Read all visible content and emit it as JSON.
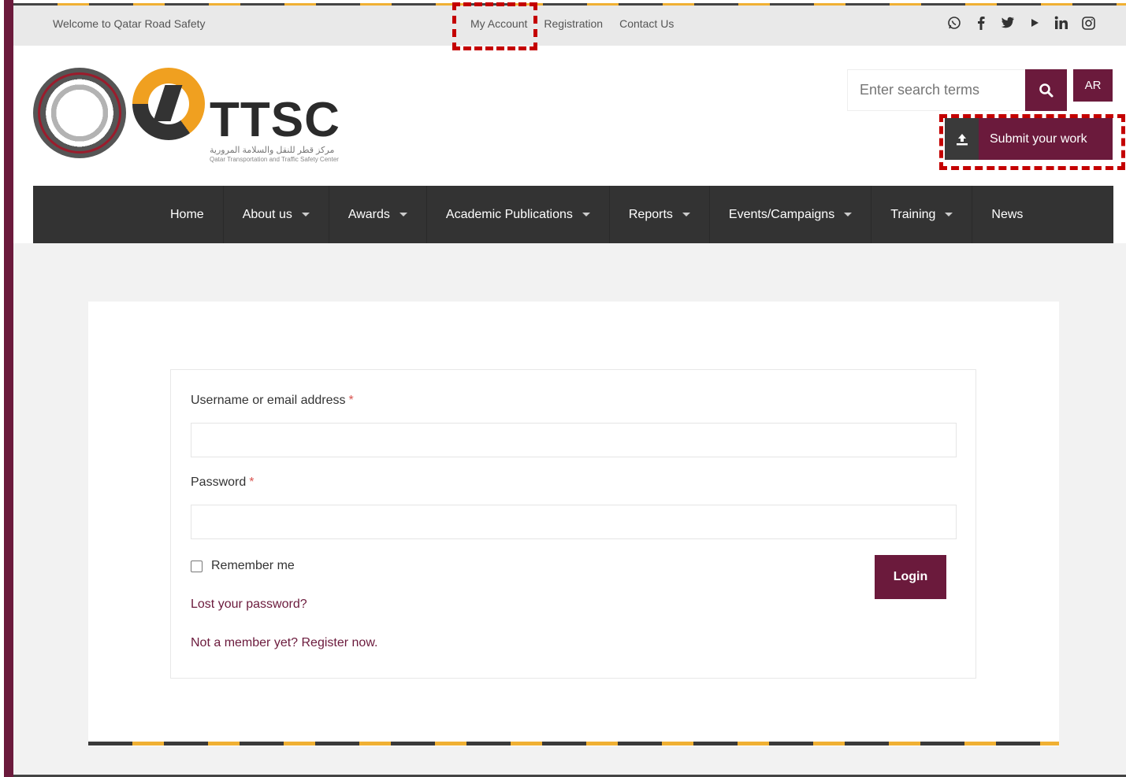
{
  "topbar": {
    "welcome": "Welcome to Qatar Road Safety",
    "links": [
      "My Account",
      "Registration",
      "Contact Us"
    ],
    "social_icons": [
      "whatsapp-icon",
      "facebook-icon",
      "twitter-icon",
      "youtube-icon",
      "linkedin-icon",
      "instagram-icon"
    ]
  },
  "logo": {
    "title": "TTSC",
    "subtitle_ar": "مركز قطر للنقل والسلامة المرورية",
    "subtitle_en": "Qatar Transportation and Traffic Safety Center"
  },
  "search": {
    "placeholder": "Enter search terms"
  },
  "lang_button": "AR",
  "submit_button": "Submit your work",
  "nav": {
    "items": [
      {
        "label": "Home",
        "dropdown": false
      },
      {
        "label": "About us",
        "dropdown": true
      },
      {
        "label": "Awards",
        "dropdown": true
      },
      {
        "label": "Academic Publications",
        "dropdown": true
      },
      {
        "label": "Reports",
        "dropdown": true
      },
      {
        "label": "Events/Campaigns",
        "dropdown": true
      },
      {
        "label": "Training",
        "dropdown": true
      },
      {
        "label": "News",
        "dropdown": false
      }
    ]
  },
  "login_form": {
    "username_label": "Username or email address",
    "password_label": "Password",
    "required_mark": "*",
    "remember_label": "Remember me",
    "login_button": "Login",
    "lost_password": "Lost your password?",
    "register_link": "Not a member yet? Register now."
  },
  "colors": {
    "brand": "#6b1a3c",
    "nav_bg": "#333333",
    "accent": "#f0b033",
    "highlight": "#c40000"
  }
}
